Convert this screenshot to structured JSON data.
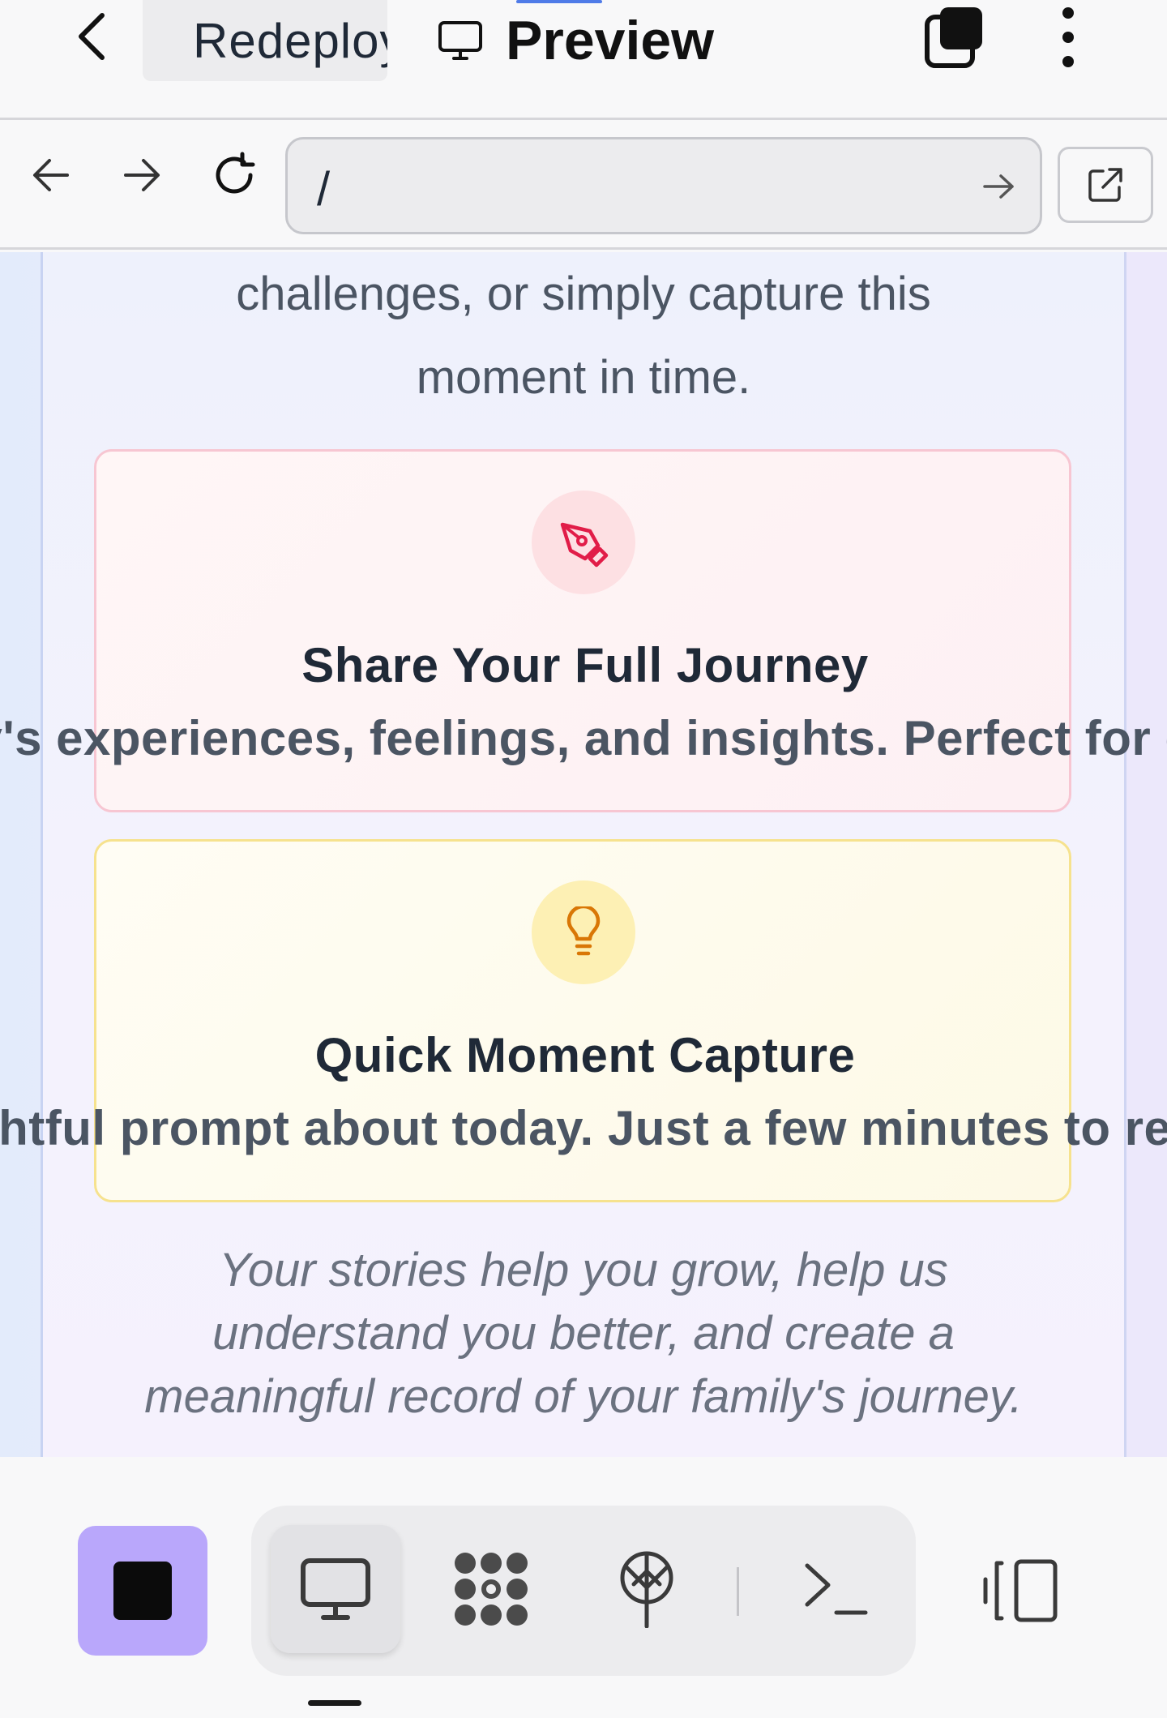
{
  "app": {
    "tabs": [
      {
        "label": "Redeploy",
        "icon": "deploy-tree-icon"
      },
      {
        "label": "Preview",
        "icon": "monitor-icon"
      }
    ]
  },
  "browser": {
    "url": "/"
  },
  "content": {
    "intro_line1": "challenges, or simply capture this",
    "intro_line2": "moment in time.",
    "cards": [
      {
        "title": "Share Your Full Journey",
        "description": "ay's experiences, feelings, and insights. Perfect for de",
        "icon": "pen-icon",
        "accent": "#e11d48"
      },
      {
        "title": "Quick Moment Capture",
        "description": "ghtful prompt about today. Just a few minutes to refl",
        "icon": "lightbulb-icon",
        "accent": "#d97706"
      }
    ],
    "closing_line1": "Your stories help you grow, help us",
    "closing_line2": "understand you better, and create a",
    "closing_line3": "meaningful record of your family's journey."
  },
  "toolbar": {
    "stop_color": "#b9a7fb",
    "tools": [
      "monitor-icon",
      "dots-grid-icon",
      "deploy-icon",
      "terminal-icon"
    ],
    "side": "panel-toggle-icon"
  }
}
